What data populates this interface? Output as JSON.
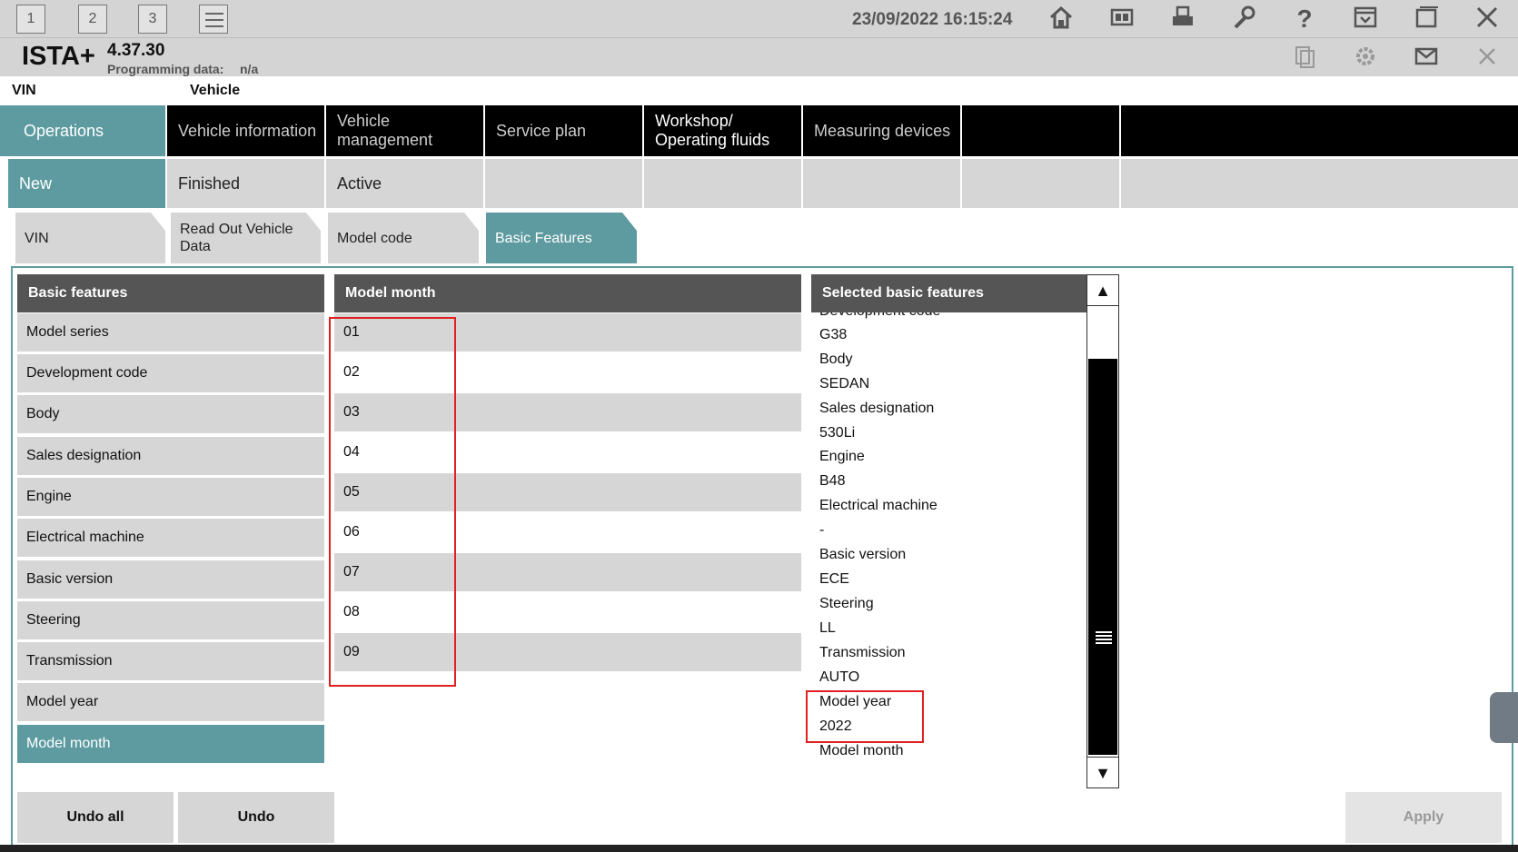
{
  "toolbar": {
    "tab1": "1",
    "tab2": "2",
    "tab3": "3",
    "datetime": "23/09/2022 16:15:24",
    "icons": [
      "list-icon",
      "home-icon",
      "vehicle-data-icon",
      "print-icon",
      "wrench-icon",
      "help-icon",
      "dropdown-menu-icon",
      "window-restore-icon",
      "close-icon"
    ]
  },
  "header": {
    "app_name": "ISTA+",
    "version": "4.37.30",
    "programming_label": "Programming data:",
    "programming_value": "n/a"
  },
  "vehicle_row": {
    "vin_label": "VIN",
    "vehicle_label": "Vehicle"
  },
  "main_tabs": [
    {
      "label": "Operations",
      "active": true
    },
    {
      "label": "Vehicle information"
    },
    {
      "label": "Vehicle management"
    },
    {
      "label": "Service plan"
    },
    {
      "label": "Workshop/ Operating fluids"
    },
    {
      "label": "Measuring devices"
    }
  ],
  "sub_tabs": [
    {
      "label": "New",
      "active": true
    },
    {
      "label": "Finished"
    },
    {
      "label": "Active"
    }
  ],
  "wizard_tabs": [
    {
      "label": "VIN"
    },
    {
      "label": "Read Out Vehicle Data"
    },
    {
      "label": "Model code"
    },
    {
      "label": "Basic Features",
      "active": true
    }
  ],
  "basic_features": {
    "header": "Basic features",
    "items": [
      "Model series",
      "Development code",
      "Body",
      "Sales designation",
      "Engine",
      "Electrical machine",
      "Basic version",
      "Steering",
      "Transmission",
      "Model year",
      "Model month"
    ],
    "selected": "Model month"
  },
  "model_month": {
    "header": "Model month",
    "items": [
      "01",
      "02",
      "03",
      "04",
      "05",
      "06",
      "07",
      "08",
      "09"
    ]
  },
  "selected_features": {
    "header": "Selected basic features",
    "partial_top": "Development code",
    "items": [
      "G38",
      "Body",
      "SEDAN",
      "Sales designation",
      "530Li",
      "Engine",
      "B48",
      "Electrical machine",
      "-",
      "Basic version",
      "ECE",
      "Steering",
      "LL",
      "Transmission",
      "AUTO",
      "Model year",
      "2022",
      "Model month"
    ]
  },
  "buttons": {
    "undo_all": "Undo all",
    "undo": "Undo",
    "apply": "Apply"
  },
  "colors": {
    "accent": "#5e9ba0",
    "header_gray": "#555555",
    "highlight_red": "#e02020"
  }
}
